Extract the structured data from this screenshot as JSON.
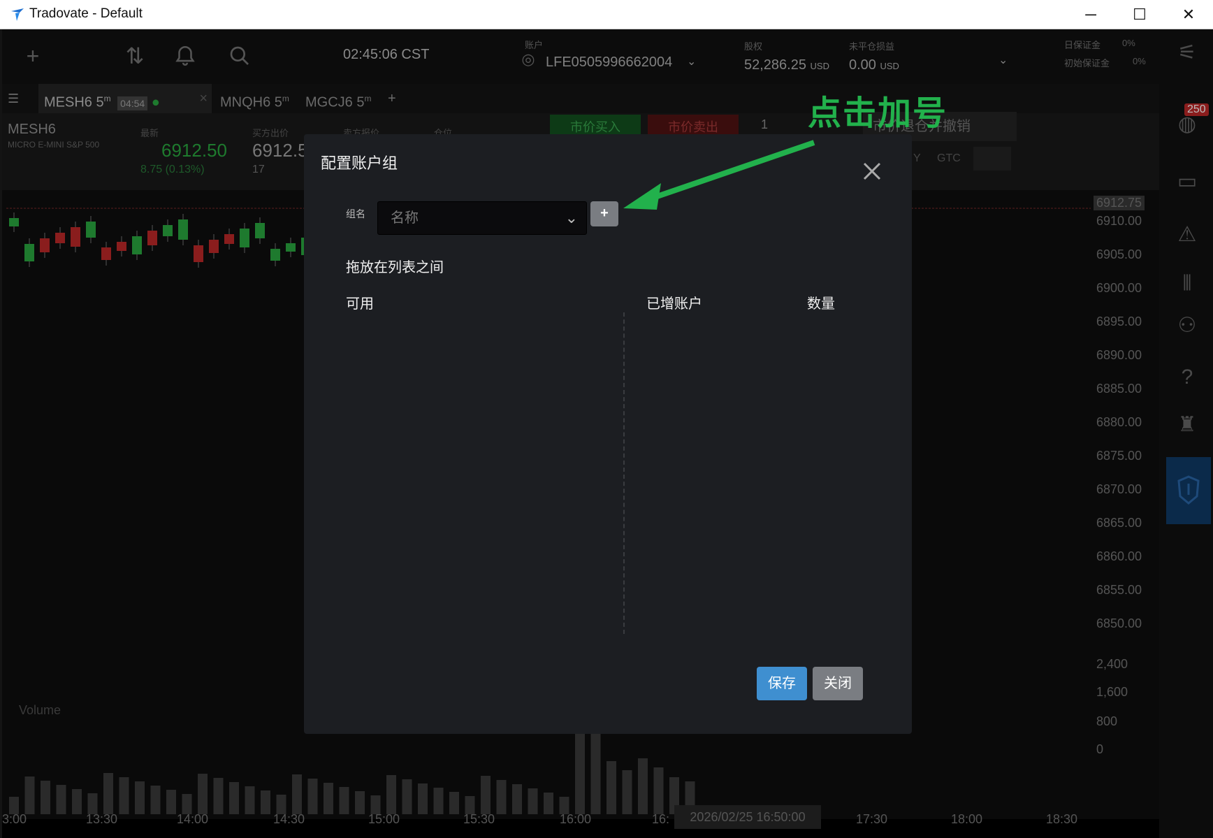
{
  "window": {
    "title": "Tradovate - Default"
  },
  "topbar": {
    "clock": "02:45:06 CST",
    "account_label": "账户",
    "account_id": "LFE0505996662004",
    "equity_label": "股权",
    "equity_value": "52,286.25",
    "equity_unit": "USD",
    "open_pnl_label": "未平仓损益",
    "open_pnl_value": "0.00",
    "open_pnl_unit": "USD",
    "day_margin_label": "日保证金",
    "day_margin_pct": "0%",
    "init_margin_label": "初始保证金",
    "init_margin_pct": "0%"
  },
  "tabs": [
    {
      "label": "MESH6 5",
      "sup": "m",
      "badge": "04:54"
    },
    {
      "label": "MNQH6 5",
      "sup": "m"
    },
    {
      "label": "MGCJ6 5",
      "sup": "m"
    }
  ],
  "symbol": {
    "code": "MESH6",
    "name": "MICRO E-MINI S&P 500",
    "last_label": "最新",
    "last": "6912.50",
    "change": "8.75 (0.13%)",
    "bid_label": "买方出价",
    "bid": "6912.5",
    "bid_size": "17",
    "ask_label": "卖方报价",
    "pos_label": "仓位",
    "buy_mkt": "市价买入",
    "sell_mkt": "市价卖出",
    "qty": "1",
    "flatten": "市价退仓并撤销",
    "tif_day": "Y",
    "tif_gtc": "GTC"
  },
  "price_axis": [
    "6912.75",
    "6910.00",
    "6905.00",
    "6900.00",
    "6895.00",
    "6890.00",
    "6885.00",
    "6880.00",
    "6875.00",
    "6870.00",
    "6865.00",
    "6860.00",
    "6855.00",
    "6850.00",
    "2,400",
    "1,600",
    "800",
    "0"
  ],
  "time_axis": [
    "3:00",
    "13:30",
    "14:00",
    "14:30",
    "15:00",
    "15:30",
    "16:00",
    "16:",
    "17:30",
    "18:00",
    "18:30"
  ],
  "crosshair_time": "2026/02/25 16:50:00",
  "volume_label": "Volume",
  "sidebar_badge": "250",
  "annotation": "点击加号",
  "modal": {
    "title": "配置账户组",
    "group_label": "组名",
    "name_placeholder": "名称",
    "plus": "+",
    "drag_hint": "拖放在列表之间",
    "col_available": "可用",
    "col_added": "已增账户",
    "col_qty": "数量",
    "save": "保存",
    "close": "关闭"
  },
  "colors": {
    "accent_green": "#22b14c",
    "save_blue": "#3f8fd0",
    "btn_gray": "#7a7d82",
    "candle_up": "#1e7a2e",
    "candle_down": "#8a1d1d"
  }
}
